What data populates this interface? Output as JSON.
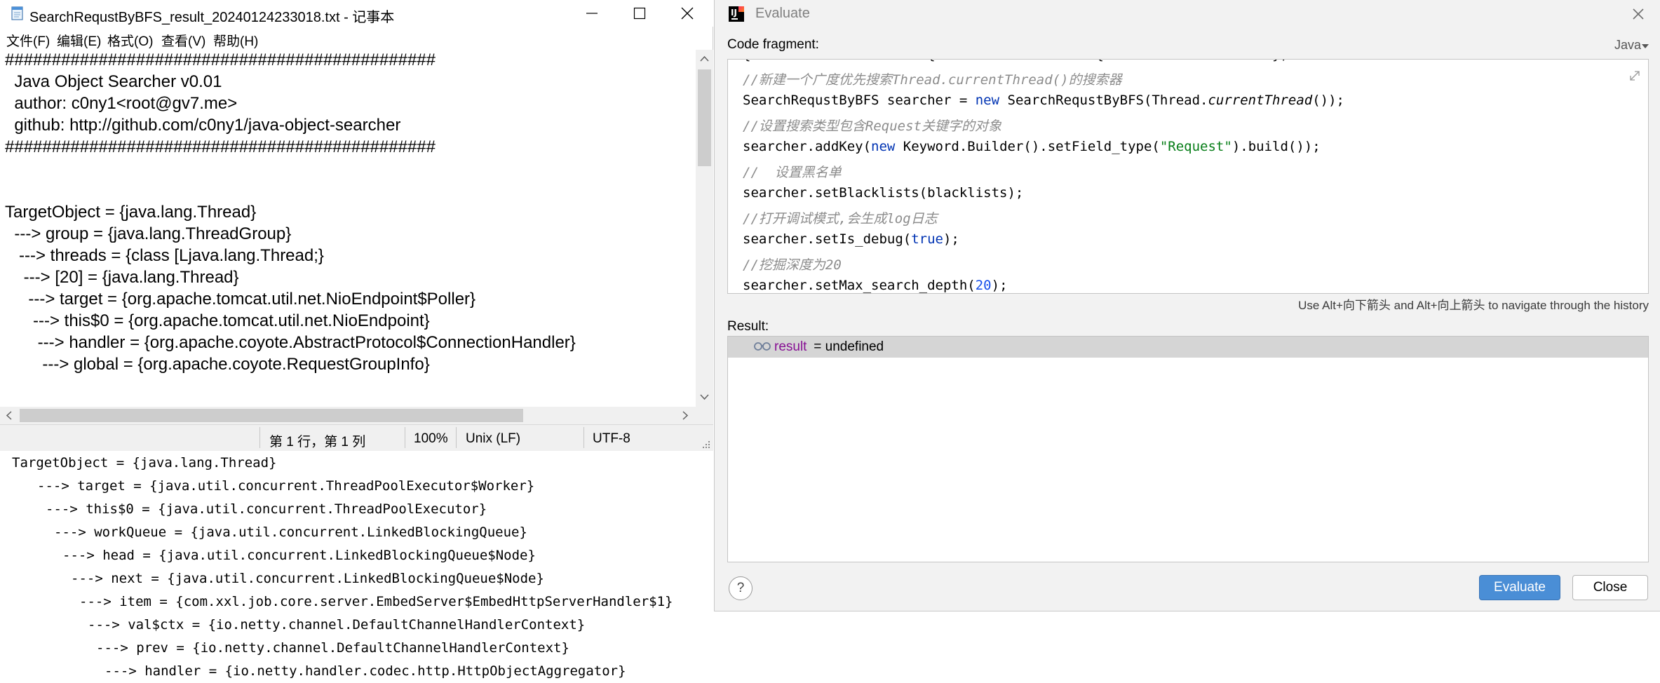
{
  "notepad": {
    "title": "SearchRequstByBFS_result_20240124233018.txt - 记事本",
    "menu": [
      "文件(F)",
      "编辑(E)",
      "格式(O)",
      "查看(V)",
      "帮助(H)"
    ],
    "lines": [
      "##############################################",
      "  Java Object Searcher v0.01",
      "  author: c0ny1<root@gv7.me>",
      "  github: http://github.com/c0ny1/java-object-searcher",
      "##############################################",
      "",
      "",
      "TargetObject = {java.lang.Thread}",
      "  ---> group = {java.lang.ThreadGroup}",
      "   ---> threads = {class [Ljava.lang.Thread;}",
      "    ---> [20] = {java.lang.Thread}",
      "     ---> target = {org.apache.tomcat.util.net.NioEndpoint$Poller}",
      "      ---> this$0 = {org.apache.tomcat.util.net.NioEndpoint}",
      "       ---> handler = {org.apache.coyote.AbstractProtocol$ConnectionHandler}",
      "        ---> global = {org.apache.coyote.RequestGroupInfo}"
    ],
    "status": {
      "position": "第 1 行，第 1 列",
      "zoom": "100%",
      "line_ending": "Unix (LF)",
      "encoding": "UTF-8"
    }
  },
  "console": {
    "lines": [
      "TargetObject = {java.lang.Thread}",
      "---> target = {java.util.concurrent.ThreadPoolExecutor$Worker}",
      "---> this$0 = {java.util.concurrent.ThreadPoolExecutor}",
      "---> workQueue = {java.util.concurrent.LinkedBlockingQueue}",
      "---> head = {java.util.concurrent.LinkedBlockingQueue$Node}",
      "---> next = {java.util.concurrent.LinkedBlockingQueue$Node}",
      "---> item = {com.xxl.job.core.server.EmbedServer$EmbedHttpServerHandler$1}",
      "---> val$ctx = {io.netty.channel.DefaultChannelHandlerContext}",
      "---> prev = {io.netty.channel.DefaultChannelHandlerContext}",
      "---> handler = {io.netty.handler.codec.http.HttpObjectAggregator}"
    ]
  },
  "evaluate": {
    "title": "Evaluate",
    "code_label": "Code fragment:",
    "language": "Java",
    "code": {
      "c1": "//新建一个广度优先搜索",
      "c1_it": "Thread.currentThread()",
      "c1_end": "的搜索器",
      "l2_a": "SearchRequstByBFS searcher = ",
      "l2_kw": "new",
      "l2_b": " SearchRequstByBFS(Thread.",
      "l2_it": "currentThread",
      "l2_c": "());",
      "c3": "//设置搜索类型包含Request关键字的对象",
      "l4_a": "searcher.addKey(",
      "l4_kw": "new",
      "l4_b": " Keyword.Builder().setField_type(",
      "l4_str": "\"Request\"",
      "l4_c": ").build());",
      "c5": "//  设置黑名单",
      "l6": "searcher.setBlacklists(blacklists);",
      "c7": "//打开调试模式,会生成log日志",
      "l8_a": "searcher.setIs_debug(",
      "l8_kw": "true",
      "l8_b": ");",
      "c9": "//挖掘深度为20",
      "l10_a": "searcher.setMax_search_depth(",
      "l10_num": "20",
      "l10_b": ");"
    },
    "history_hint": "Use Alt+向下箭头 and Alt+向上箭头 to navigate through the history",
    "result_label": "Result:",
    "result_name": "result",
    "result_value": " = undefined",
    "help_label": "?",
    "evaluate_button": "Evaluate",
    "close_button": "Close"
  }
}
